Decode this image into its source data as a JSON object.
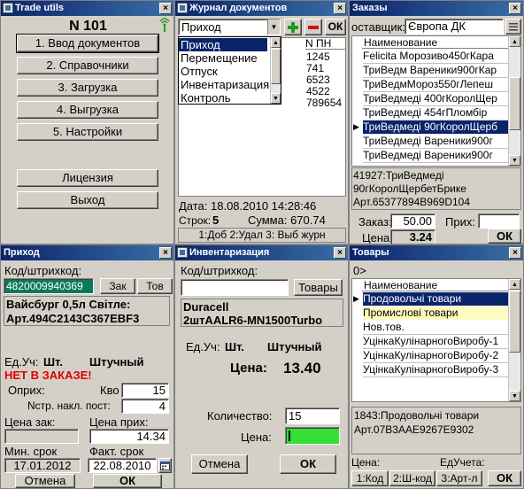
{
  "w1": {
    "title": "Trade utils",
    "header": "N 101",
    "menu": [
      "1. Ввод документов",
      "2. Справочники",
      "3. Загрузка",
      "4. Выгрузка",
      "5. Настройки"
    ],
    "license": "Лицензия",
    "exit": "Выход"
  },
  "w2": {
    "title": "Журнал документов",
    "select_value": "Приход",
    "ok": "ОК",
    "dropdown": [
      "Приход",
      "Перемещение",
      "Отпуск",
      "Инвентаризация",
      "Контроль"
    ],
    "col_header": "N ПН",
    "numbers": [
      "1245",
      "741",
      "6523",
      "4522",
      "789654"
    ],
    "date": "Дата: 18.08.2010 14:28:46",
    "rows_label": "Строк:",
    "rows_value": "5",
    "sum": "Сумма: 670.74",
    "footer": "1:Доб  2:Удал  3: Выб журн"
  },
  "w3": {
    "title": "Заказы",
    "supplier_label": "оставщик:",
    "supplier_value": "Європа ДК",
    "col_header": "Наименование",
    "items": [
      "Felicita Морозиво450гКара",
      "ТриВедм Вареники900гКар",
      "ТриВедмМороз550гЛепеш",
      "ТриВедмеді 400гКоролЩер",
      "ТриВедмеді 454гПломбір",
      "ТриВедмеді 90гКоролЩерб",
      "ТриВедмеді Вареники900г",
      "ТриВедмеді Вареники900г"
    ],
    "detail": [
      "41927:ТриВедмеді",
      "90гКоролЩербетБрике",
      "Арт.65377894B969D104"
    ],
    "order_label": "Заказ:",
    "order_value": "50.00",
    "arrival_label": "Прих:",
    "price_label": "Цена:",
    "price_value": "3.24",
    "ok": "ОК"
  },
  "w4": {
    "title": "Приход",
    "code_label": "Код/штрихкод:",
    "code_value": "4820009940369",
    "btn_order": "Зак",
    "btn_goods": "Тов",
    "desc": [
      "Вайсбург 0,5л Світле:",
      "Арт.494C2143C367EBF3"
    ],
    "unit_label": "Ед.Уч:",
    "unit_short": "Шт.",
    "unit_long": "Штучный",
    "not_in_order": "НЕТ В ЗАКАЗЕ!",
    "oprih_label": "Оприх:",
    "qty_label": "Кво",
    "qty_value": "15",
    "nstr_label": "Nстр. накл. пост:",
    "nstr_value": "4",
    "price_order_label": "Цена зак:",
    "price_in_label": "Цена прих:",
    "price_in_value": "14.34",
    "min_term_label": "Мин. срок",
    "fact_term_label": "Факт. срок",
    "min_term_value": "17.01.2012",
    "fact_term_value": "22.08.2010",
    "cancel": "Отмена",
    "ok": "ОК"
  },
  "w5": {
    "title": "Инвентаризация",
    "code_label": "Код/штрихкод:",
    "btn_goods": "Товары",
    "desc": [
      "Duracell",
      "2штAALR6-MN1500Turbo"
    ],
    "unit_label": "Ед.Уч:",
    "unit_short": "Шт.",
    "unit_long": "Штучный",
    "price_label": "Цена:",
    "price_value": "13.40",
    "qty_label": "Количество:",
    "qty_value": "15",
    "price_in_label": "Цена:",
    "cancel": "Отмена",
    "ok": "ОК"
  },
  "w6": {
    "title": "Товары",
    "path": "0>",
    "col_header": "Наименование",
    "items": [
      "Продовольчі товари",
      "Промислові товари",
      "Нов.тов.",
      "УцінкаКулінарногоВиробу-1",
      "УцінкаКулінарногоВиробу-2",
      "УцінкаКулінарногоВиробу-3"
    ],
    "detail": [
      "1843:Продовольчі товари",
      "Арт.07B3AAE9267E9302"
    ],
    "price_label": "Цена:",
    "unit_label": "ЕдУчета:",
    "footer": [
      "1:Код",
      "2:Ш-код",
      "3:Арт-л"
    ],
    "ok": "ОК"
  },
  "colors": {
    "title_start": "#0a246a",
    "title_end": "#3a6ea5",
    "selection": "#0a246a",
    "highlight": "#fffbbf",
    "warn": "#e00000",
    "green_field": "#33e033",
    "barcode_field": "#0a7a5a"
  },
  "icons": [
    "antenna-icon",
    "plus-icon",
    "minus-icon",
    "dropdown-arrow-icon",
    "calendar-icon",
    "close-icon"
  ]
}
